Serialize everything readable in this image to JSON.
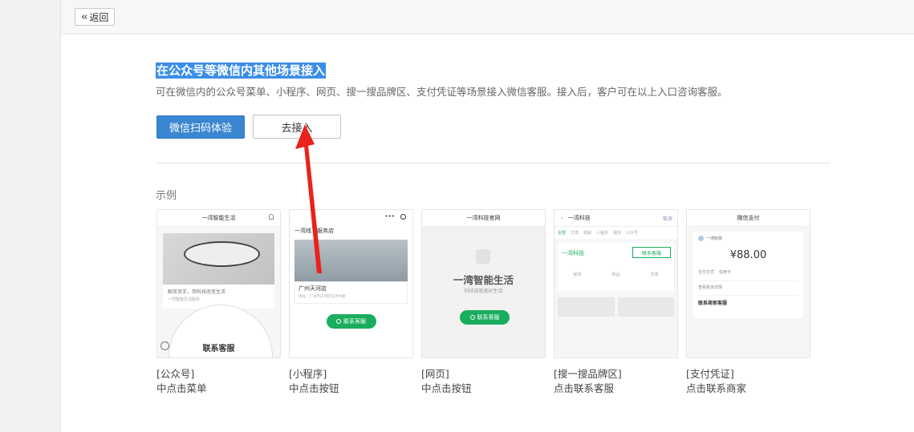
{
  "header": {
    "back_label": "返回"
  },
  "section": {
    "title": "在公众号等微信内其他场景接入",
    "description": "可在微信内的公众号菜单、小程序、网页、搜一搜品牌区、支付凭证等场景接入微信客服。接入后，客户可在以上入口咨询客服。",
    "primary_button": "微信扫码体验",
    "secondary_button": "去接入",
    "examples_label": "示例"
  },
  "examples": [
    {
      "caption_line1": "[公众号]",
      "caption_line2": "中点击菜单",
      "header": "一湾智能生活",
      "text1": "解放双手，用科技改变生活",
      "text2": "一湾智能生活服务",
      "button": "联系客服"
    },
    {
      "caption_line1": "[小程序]",
      "caption_line2": "中点击按钮",
      "header": "",
      "store_title": "一湾线下服务店",
      "store_name": "广州天河店",
      "store_addr": "地址：广州市天河区天河中路",
      "button": "联系客服"
    },
    {
      "caption_line1": "[网页]",
      "caption_line2": "中点击按钮",
      "header": "一湾科技官网",
      "brand": "一湾智能生活",
      "slogan": "科技成就美好生活",
      "button": "联系客服"
    },
    {
      "caption_line1": "[搜一搜品牌区]",
      "caption_line2": "点击联系客服",
      "header": "一湾科技",
      "search_right": "取消",
      "brand": "一湾科技",
      "button": "联系客服",
      "tabs": [
        "全部",
        "文章",
        "视频",
        "小程序",
        "服务",
        "公众号"
      ],
      "icons": [
        "官网",
        "新品",
        "优惠"
      ]
    },
    {
      "caption_line1": "[支付凭证]",
      "caption_line2": "点击联系商家",
      "header": "微信支付",
      "merchant": "一湾科技",
      "amount": "¥88.00",
      "row1": "支付方式",
      "row1_val": "信用卡",
      "row2": "查看账单详情",
      "row3": "联系商家客服"
    }
  ]
}
